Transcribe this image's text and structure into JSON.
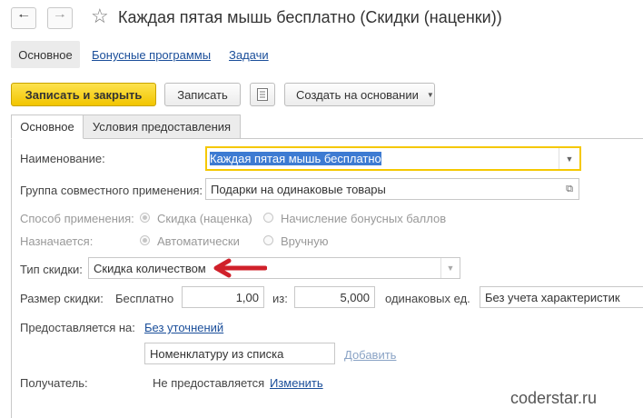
{
  "window": {
    "title": "Каждая пятая мышь бесплатно (Скидки (наценки))"
  },
  "sections": {
    "main": "Основное",
    "bonus": "Бонусные программы",
    "tasks": "Задачи"
  },
  "toolbar": {
    "save_close": "Записать и закрыть",
    "save": "Записать",
    "create_based": "Создать на основании"
  },
  "tabs": [
    {
      "label": "Основное"
    },
    {
      "label": "Условия предоставления"
    }
  ],
  "form": {
    "name_label": "Наименование:",
    "name_value": "Каждая пятая мышь бесплатно",
    "group_label": "Группа совместного применения:",
    "group_value": "Подарки на одинаковые товары",
    "method_label": "Способ применения:",
    "method_opt1": "Скидка (наценка)",
    "method_opt2": "Начисление бонусных баллов",
    "assign_label": "Назначается:",
    "assign_opt1": "Автоматически",
    "assign_opt2": "Вручную",
    "type_label": "Тип скидки:",
    "type_value": "Скидка количеством",
    "size_label": "Размер скидки:",
    "free_label": "Бесплатно",
    "free_value": "1,00",
    "of_label": "из:",
    "of_value": "5,000",
    "same_units_label": "одинаковых ед.",
    "characteristics_value": "Без учета характеристик",
    "provided_label": "Предоставляется на:",
    "provided_link": "Без уточнений",
    "nomenclature_value": "Номенклатуру из списка",
    "add_link": "Добавить",
    "recipient_label": "Получатель:",
    "recipient_value": "Не предоставляется",
    "change_link": "Изменить"
  },
  "watermark": "coderstar.ru",
  "colors": {
    "accent_yellow": "#f5c800",
    "link_blue": "#1a4e9a",
    "arrow_red": "#d0202a",
    "selection": "#3d7bd2"
  }
}
